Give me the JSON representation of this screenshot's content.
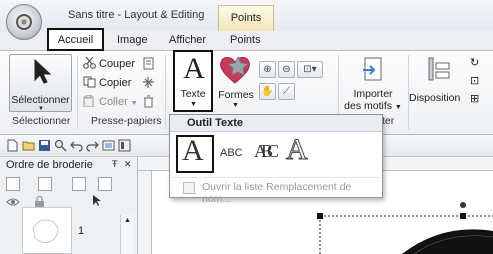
{
  "window": {
    "title": "Sans titre - Layout & Editing",
    "context_tab": "Points"
  },
  "tabs": [
    {
      "label": "Accueil"
    },
    {
      "label": "Image"
    },
    {
      "label": "Afficher"
    },
    {
      "label": "Points"
    }
  ],
  "ribbon": {
    "select_label": "Sélectionner",
    "clipboard": {
      "cut": "Couper",
      "copy": "Copier",
      "paste": "Coller"
    },
    "text_label": "Texte",
    "shapes_label": "Formes",
    "import_label_1": "Importer",
    "import_label_2": "des motifs",
    "layout_label": "Disposition",
    "groups": {
      "select": "Sélectionner",
      "clipboard": "Presse-papiers",
      "import_fragment": "ter"
    }
  },
  "panel": {
    "title": "Ordre de broderie",
    "item_number": "1",
    "close_glyph": "✕",
    "pin_glyph": "Ŧ"
  },
  "dropdown": {
    "title": "Outil Texte",
    "items": [
      {
        "glyph": "A"
      },
      {
        "glyph": "ABC"
      },
      {
        "glyph": "ABC"
      },
      {
        "glyph": "A"
      }
    ],
    "footer": "Ouvrir la liste Remplacement de nom..."
  },
  "icons": {
    "select": "arrow-pointer-icon",
    "cut": "scissors-icon",
    "copy": "copy-icon",
    "paste": "paste-icon",
    "text": "letter-a-icon",
    "shapes": "heart-shape-icon",
    "zoom_in": "zoom-in-icon",
    "zoom_out": "zoom-out-icon",
    "pan": "hand-icon"
  },
  "colors": {
    "accent": "#3a7bd5",
    "highlight_border": "#111111",
    "shape_fill": "#c83a57"
  }
}
